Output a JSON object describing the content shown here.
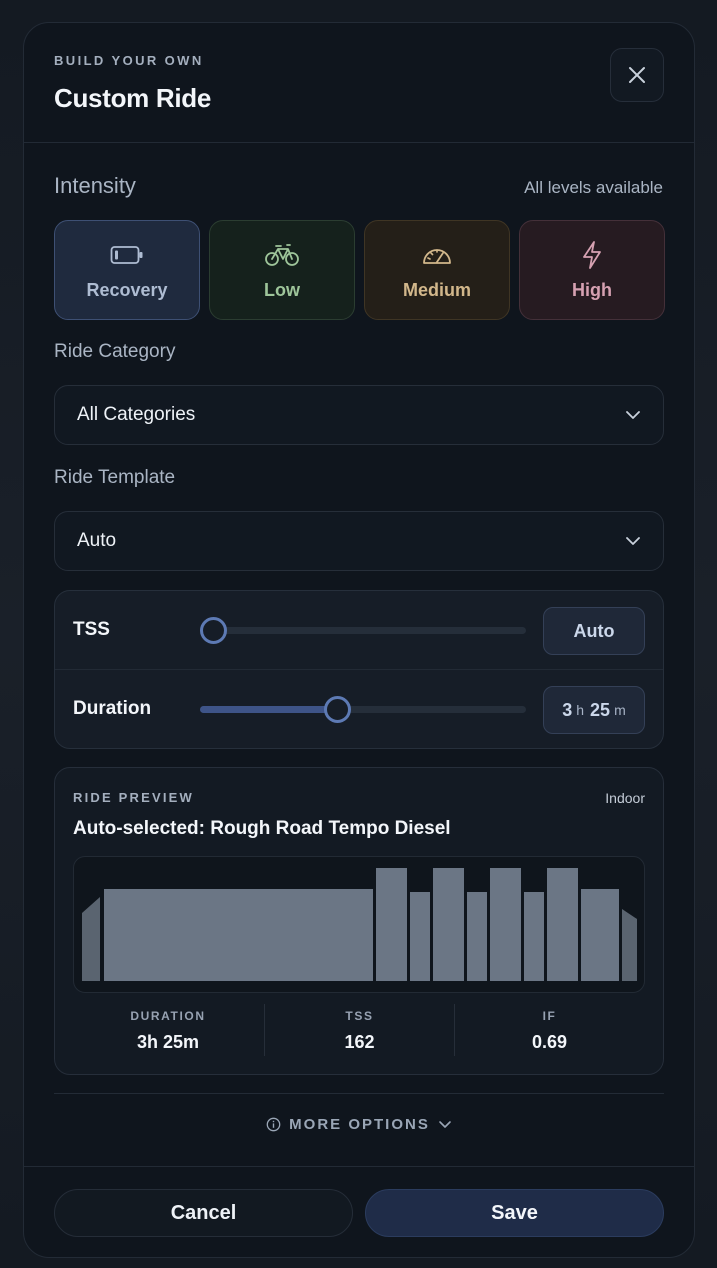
{
  "header": {
    "eyebrow": "BUILD YOUR OWN",
    "title": "Custom Ride",
    "close_icon": "close-icon"
  },
  "intensity": {
    "label": "Intensity",
    "availability": "All levels available",
    "options": [
      {
        "label": "Recovery",
        "icon": "battery-icon",
        "color": "#aebcd2",
        "selected": true
      },
      {
        "label": "Low",
        "icon": "bicycle-icon",
        "color": "#9ec59a",
        "selected": false
      },
      {
        "label": "Medium",
        "icon": "gauge-icon",
        "color": "#d2b78b",
        "selected": false
      },
      {
        "label": "High",
        "icon": "lightning-icon",
        "color": "#d6a1b2",
        "selected": false
      }
    ]
  },
  "ride_category": {
    "label": "Ride Category",
    "value": "All Categories"
  },
  "ride_template": {
    "label": "Ride Template",
    "value": "Auto"
  },
  "sliders": {
    "tss": {
      "label": "TSS",
      "value": "Auto",
      "position_fraction": 0.0
    },
    "duration": {
      "label": "Duration",
      "hours": "3",
      "hours_unit": "h",
      "minutes": "25",
      "minutes_unit": "m",
      "position_fraction": 0.42
    }
  },
  "preview": {
    "eyebrow": "RIDE PREVIEW",
    "tag": "Indoor",
    "title": "Auto-selected: Rough Road Tempo Diesel",
    "stats": [
      {
        "label": "DURATION",
        "value": "3h 25m"
      },
      {
        "label": "TSS",
        "value": "162"
      },
      {
        "label": "IF",
        "value": "0.69"
      }
    ]
  },
  "more_options": {
    "label": "MORE OPTIONS"
  },
  "footer": {
    "cancel_label": "Cancel",
    "save_label": "Save"
  },
  "colors": {
    "accent": "#5d7ab4",
    "profile_bar": "#6b7685",
    "profile_bar_edge": "#5a6470"
  }
}
